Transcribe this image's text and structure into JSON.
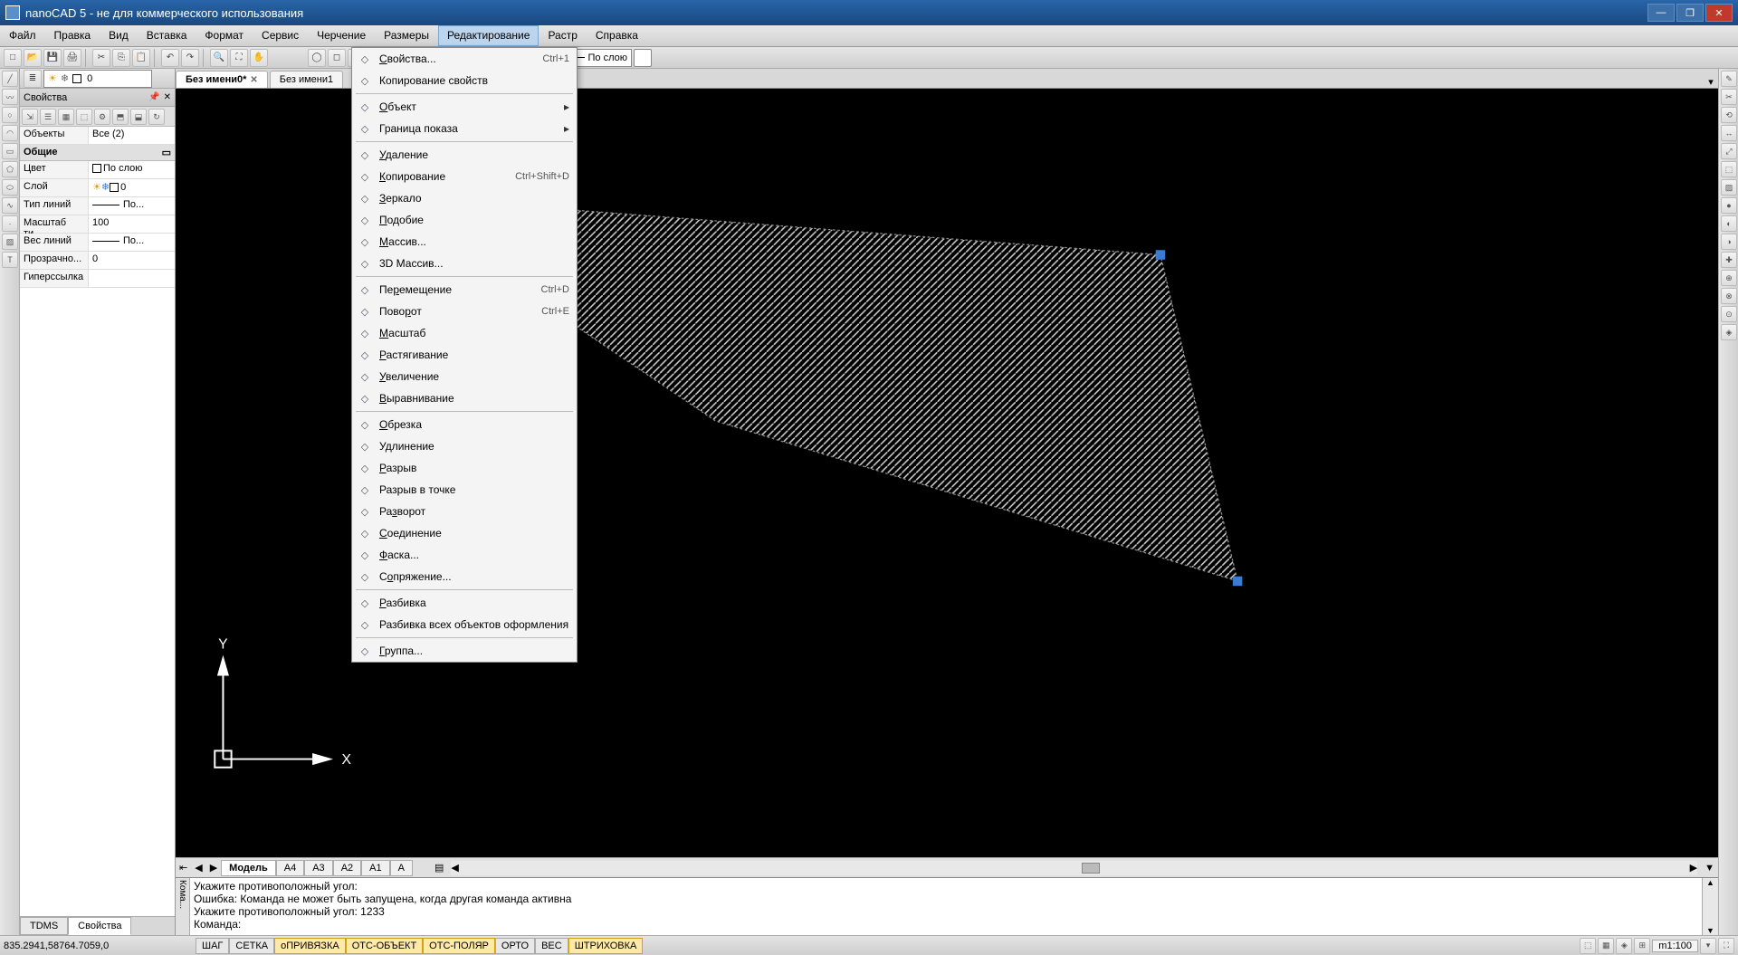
{
  "title": "nanoCAD 5 - не для коммерческого использования",
  "menubar": [
    "Файл",
    "Правка",
    "Вид",
    "Вставка",
    "Формат",
    "Сервис",
    "Черчение",
    "Размеры",
    "Редактирование",
    "Растр",
    "Справка"
  ],
  "menubar_active_index": 8,
  "layer_combo": "0",
  "lw_combo1": "По слою",
  "lw_combo2": "По слою",
  "doc_tabs": [
    {
      "label": "Без имени0*",
      "closable": true,
      "active": true
    },
    {
      "label": "Без имени1",
      "closable": false,
      "active": false
    }
  ],
  "properties": {
    "panel_title": "Свойства",
    "object_label": "Объекты",
    "object_value": "Все (2)",
    "group": "Общие",
    "rows": [
      {
        "k": "Цвет",
        "v": "По слою",
        "sw": true
      },
      {
        "k": "Слой",
        "v": "0",
        "icons": true
      },
      {
        "k": "Тип линий",
        "v": "———По...",
        "line": true
      },
      {
        "k": "Масштаб ти...",
        "v": "100"
      },
      {
        "k": "Вес линий",
        "v": "———По...",
        "line": true
      },
      {
        "k": "Прозрачно...",
        "v": "0"
      },
      {
        "k": "Гиперссылка",
        "v": ""
      }
    ],
    "tabs": [
      "TDMS",
      "Свойства"
    ],
    "active_tab": 1
  },
  "dropdown": [
    {
      "label": "Свойства...",
      "shortcut": "Ctrl+1",
      "u": 0
    },
    {
      "label": "Копирование свойств"
    },
    {
      "sep": true
    },
    {
      "label": "Объект",
      "submenu": true,
      "u": 0
    },
    {
      "label": "Граница показа",
      "submenu": true
    },
    {
      "sep": true
    },
    {
      "label": "Удаление",
      "u": 0
    },
    {
      "label": "Копирование",
      "shortcut": "Ctrl+Shift+D",
      "u": 0
    },
    {
      "label": "Зеркало",
      "u": 0
    },
    {
      "label": "Подобие",
      "u": 0
    },
    {
      "label": "Массив...",
      "u": 0
    },
    {
      "label": "3D Массив..."
    },
    {
      "sep": true
    },
    {
      "label": "Перемещение",
      "shortcut": "Ctrl+D",
      "u": 2
    },
    {
      "label": "Поворот",
      "shortcut": "Ctrl+E",
      "u": 4
    },
    {
      "label": "Масштаб",
      "u": 0
    },
    {
      "label": "Растягивание",
      "u": 0
    },
    {
      "label": "Увеличение",
      "u": 0
    },
    {
      "label": "Выравнивание",
      "u": 0
    },
    {
      "sep": true
    },
    {
      "label": "Обрезка",
      "u": 0
    },
    {
      "label": "Удлинение",
      "u": 1
    },
    {
      "label": "Разрыв",
      "u": 0
    },
    {
      "label": "Разрыв в точке"
    },
    {
      "label": "Разворот",
      "u": 2
    },
    {
      "label": "Соединение",
      "u": 0
    },
    {
      "label": "Фаска...",
      "u": 0
    },
    {
      "label": "Сопряжение...",
      "u": 1
    },
    {
      "sep": true
    },
    {
      "label": "Разбивка",
      "u": 0
    },
    {
      "label": "Разбивка всех объектов оформления"
    },
    {
      "sep": true
    },
    {
      "label": "Группа...",
      "u": 0
    }
  ],
  "layout_tabs": [
    "Модель",
    "A4",
    "A3",
    "A2",
    "A1",
    "A"
  ],
  "layout_active": 0,
  "command_lines": [
    "Укажите противоположный угол:",
    "Ошибка: Команда не может быть запущена, когда другая команда активна",
    "Укажите противоположный угол: 1233",
    "Команда:"
  ],
  "cmd_label": "Кома...",
  "status": {
    "coords": "835.2941,58764.7059,0",
    "toggles": [
      {
        "label": "ШАГ",
        "on": false
      },
      {
        "label": "СЕТКА",
        "on": false
      },
      {
        "label": "оПРИВЯЗКА",
        "on": true
      },
      {
        "label": "ОТС-ОБЪЕКТ",
        "on": true
      },
      {
        "label": "ОТС-ПОЛЯР",
        "on": true
      },
      {
        "label": "ОРТО",
        "on": false
      },
      {
        "label": "ВЕС",
        "on": false
      },
      {
        "label": "ШТРИХОВКА",
        "on": true
      }
    ],
    "scale": "m1:100"
  }
}
